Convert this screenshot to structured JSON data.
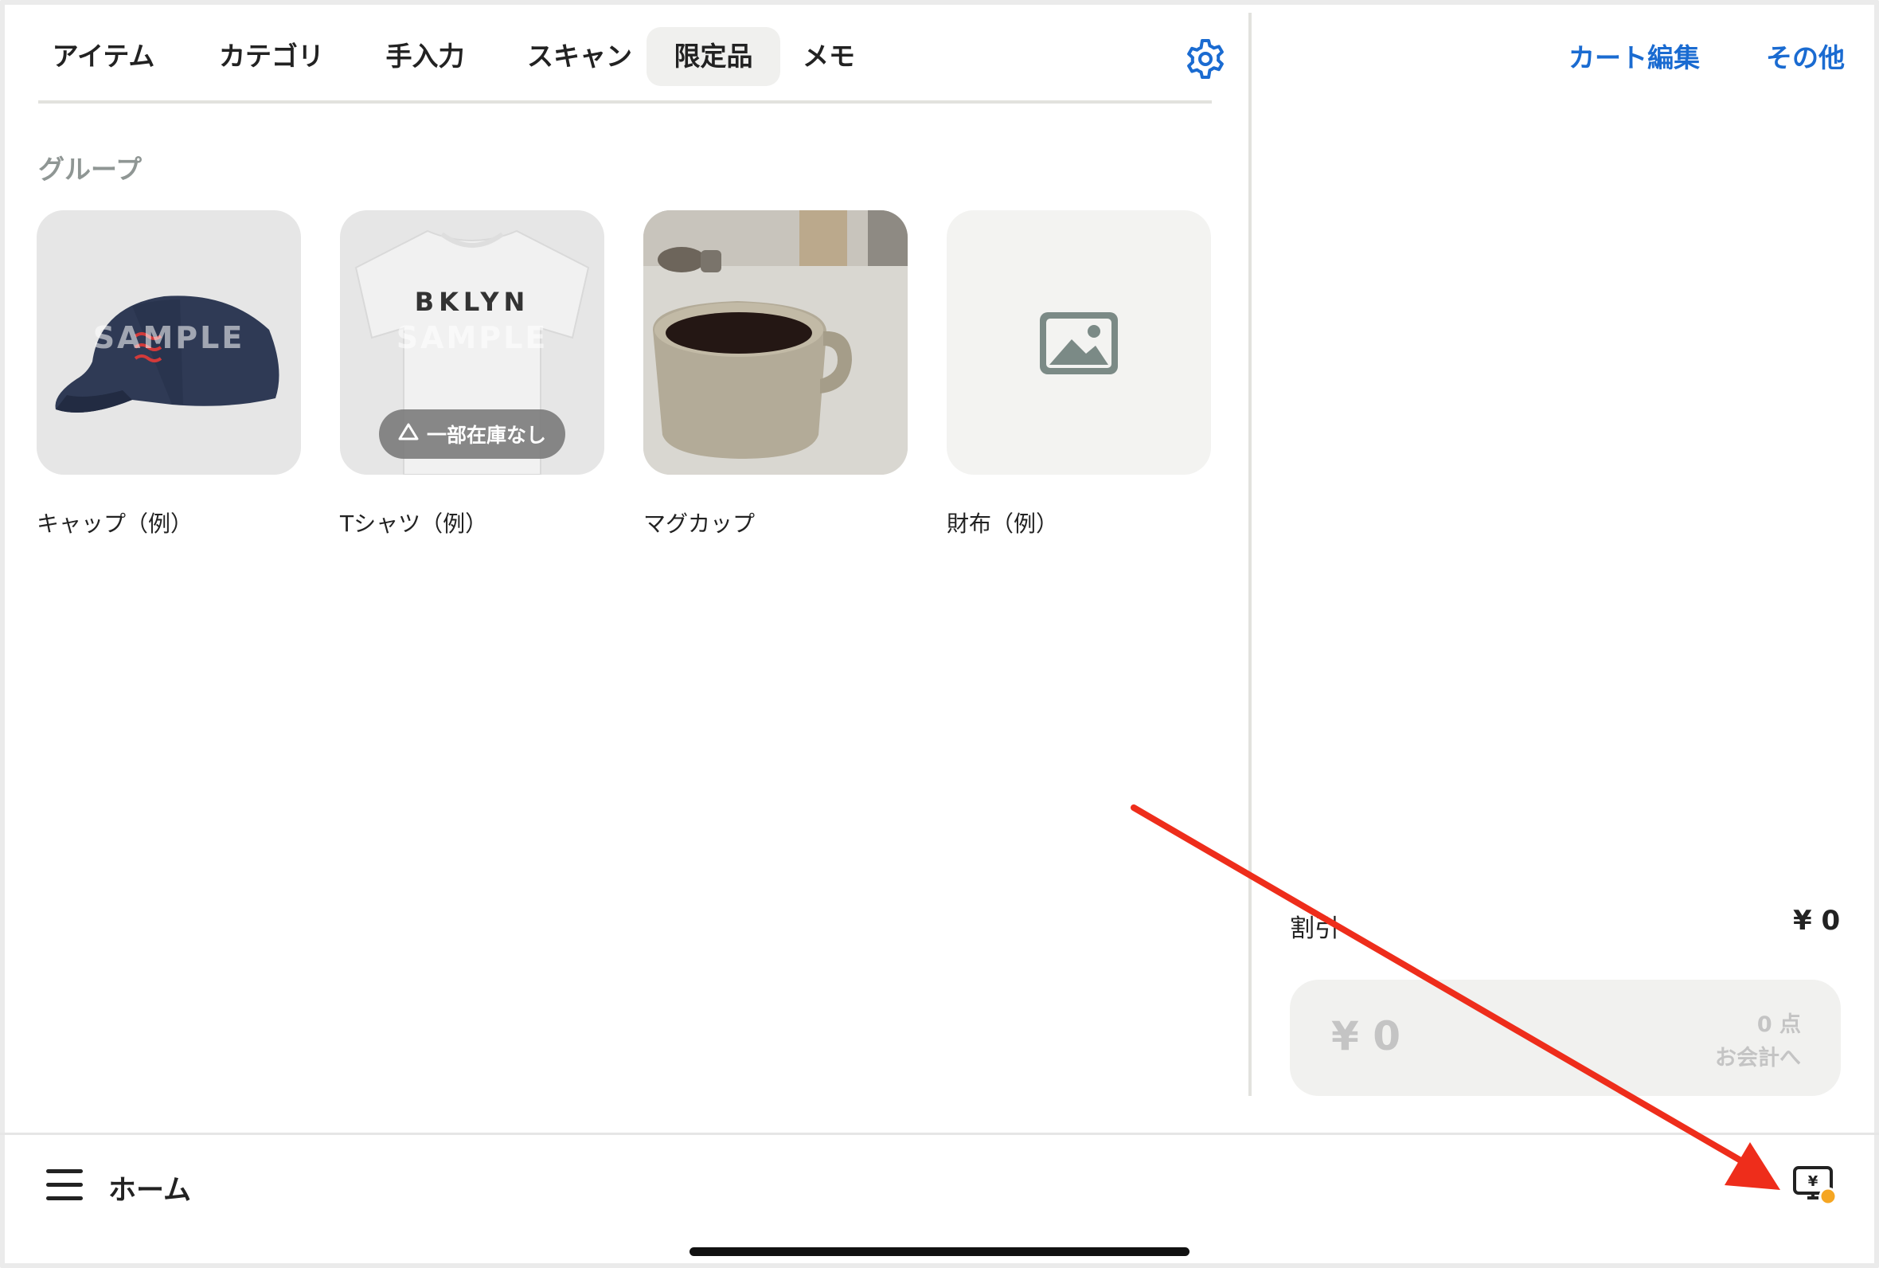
{
  "tabs": [
    {
      "label": "アイテム"
    },
    {
      "label": "カテゴリ"
    },
    {
      "label": "手入力"
    },
    {
      "label": "スキャン"
    },
    {
      "label": "限定品",
      "active": true
    },
    {
      "label": "メモ"
    }
  ],
  "section": {
    "title": "グループ"
  },
  "items": [
    {
      "name": "キャップ（例）",
      "watermark": "SAMPLE"
    },
    {
      "name": "Tシャツ（例）",
      "print": "BKLYN",
      "watermark": "SAMPLE",
      "badge": "一部在庫なし"
    },
    {
      "name": "マグカップ"
    },
    {
      "name": "財布（例）"
    }
  ],
  "cart": {
    "edit_label": "カート編集",
    "more_label": "その他",
    "discount_label": "割引",
    "discount_value": "¥ 0",
    "checkout": {
      "total": "¥ 0",
      "count": "0 点",
      "action": "お会計へ"
    }
  },
  "bottom_bar": {
    "home_label": "ホーム"
  },
  "icons": {
    "settings": "gear-icon",
    "menu": "hamburger-menu-icon",
    "register": "register-display-icon",
    "placeholder": "image-placeholder-icon",
    "badge": "warning-triangle-icon"
  },
  "colors": {
    "accent": "#1a6bd1",
    "annotation_arrow": "#ee2d1b",
    "status_dot": "#f5a623"
  }
}
